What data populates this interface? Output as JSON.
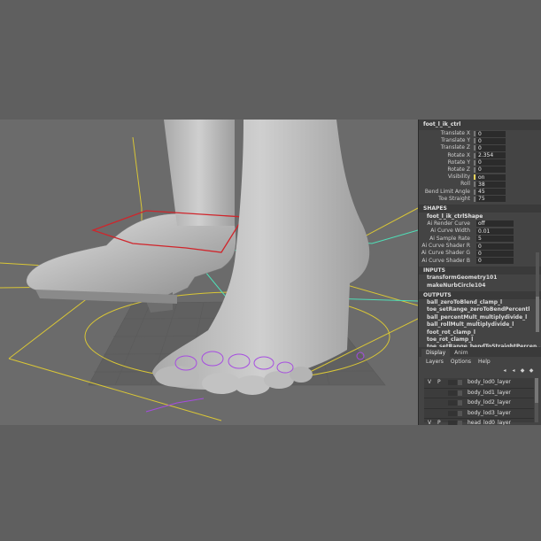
{
  "channel_box": {
    "node_name": "foot_l_ik_ctrl",
    "attributes": [
      {
        "label": "Translate X",
        "value": "0",
        "marker": "gray"
      },
      {
        "label": "Translate Y",
        "value": "0",
        "marker": "gray"
      },
      {
        "label": "Translate Z",
        "value": "0",
        "marker": "gray"
      },
      {
        "label": "Rotate X",
        "value": "2.354",
        "marker": "gray"
      },
      {
        "label": "Rotate Y",
        "value": "0",
        "marker": "gray"
      },
      {
        "label": "Rotate Z",
        "value": "0",
        "marker": "gray"
      },
      {
        "label": "Visibility",
        "value": "on",
        "marker": "yellow"
      },
      {
        "label": "Roll",
        "value": "38",
        "marker": "gray"
      },
      {
        "label": "Bend Limit Angle",
        "value": "45",
        "marker": "gray"
      },
      {
        "label": "Toe Straight",
        "value": "75",
        "marker": "gray"
      }
    ],
    "shapes_header": "SHAPES",
    "shape_name": "foot_l_ik_ctrlShape",
    "shape_attributes": [
      {
        "label": "Ai Render Curve",
        "value": "off"
      },
      {
        "label": "Ai Curve Width",
        "value": "0.01"
      },
      {
        "label": "Ai Sample Rate",
        "value": "5"
      },
      {
        "label": "Ai Curve Shader R",
        "value": "0"
      },
      {
        "label": "Ai Curve Shader G",
        "value": "0"
      },
      {
        "label": "Ai Curve Shader B",
        "value": "0"
      }
    ],
    "inputs_header": "INPUTS",
    "inputs": [
      "transformGeometry101",
      "makeNurbCircle104"
    ],
    "outputs_header": "OUTPUTS",
    "outputs": [
      "ball_zeroToBlend_clamp_l",
      "toe_setRange_zeroToBendPercentl",
      "ball_percentMult_multiplydivide_l",
      "ball_rollMult_multiplydivide_l",
      "foot_rot_clamp_l",
      "toe_rot_clamp_l",
      "toe_setRange_bendToStraightPercen..."
    ]
  },
  "layer_editor": {
    "tabs": [
      "Display",
      "Anim"
    ],
    "menu": [
      "Layers",
      "Options",
      "Help"
    ],
    "layers": [
      {
        "v": "V",
        "p": "P",
        "name": "body_lod0_layer"
      },
      {
        "v": "",
        "p": "",
        "name": "body_lod1_layer"
      },
      {
        "v": "",
        "p": "",
        "name": "body_lod2_layer"
      },
      {
        "v": "",
        "p": "",
        "name": "body_lod3_layer"
      },
      {
        "v": "V",
        "p": "P",
        "name": "head_lod0_layer"
      }
    ]
  },
  "colors": {
    "viewport_bg": "#6b6b6b",
    "panel_bg": "#444444",
    "ik_ctrl_red": "#d0252b",
    "nurbs_yellow": "#d9c636",
    "cyan_ctrl": "#4fe0b8",
    "toe_ctrl_purple": "#a64ce0"
  }
}
